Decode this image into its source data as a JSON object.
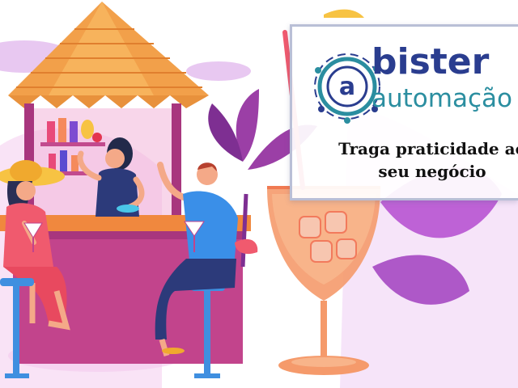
{
  "brand": {
    "name": "bister",
    "subtitle": "automação",
    "logo_letter": "a",
    "colors": {
      "navy": "#2a3d8f",
      "teal": "#2b8ea0"
    }
  },
  "tagline": {
    "line1": "Traga praticidade ao",
    "line2": "seu negócio"
  },
  "illustration": {
    "subject": "beach-bar-scene",
    "colors": {
      "hut_roof": "#f2a04a",
      "bar": "#c0458a",
      "drink": "#f59a6b",
      "leaves": "#9b3fa6"
    }
  }
}
